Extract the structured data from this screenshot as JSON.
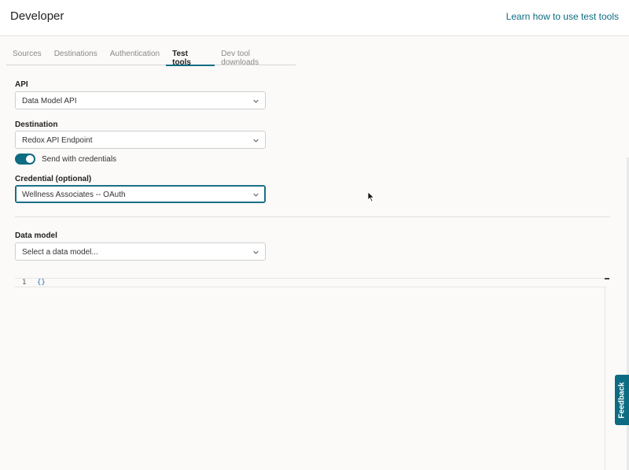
{
  "header": {
    "title": "Developer",
    "learn_link": "Learn how to use test tools"
  },
  "tabs": [
    {
      "label": "Sources"
    },
    {
      "label": "Destinations"
    },
    {
      "label": "Authentication"
    },
    {
      "label": "Test tools",
      "active": true
    },
    {
      "label": "Dev tool downloads"
    }
  ],
  "form": {
    "api": {
      "label": "API",
      "value": "Data Model API"
    },
    "destination": {
      "label": "Destination",
      "value": "Redox API Endpoint"
    },
    "send_credentials": {
      "label": "Send with credentials",
      "checked": true
    },
    "credential": {
      "label": "Credential (optional)",
      "value": "Wellness Associates -- OAuth"
    },
    "data_model": {
      "label": "Data model",
      "placeholder": "Select a data model..."
    }
  },
  "editor": {
    "line_number": "1",
    "code": "{}"
  },
  "feedback": {
    "label": "Feedback"
  },
  "colors": {
    "accent": "#0e6c82",
    "background": "#fbfaf8"
  },
  "icons": [
    "chevron-down-icon",
    "mouse-cursor-icon"
  ]
}
